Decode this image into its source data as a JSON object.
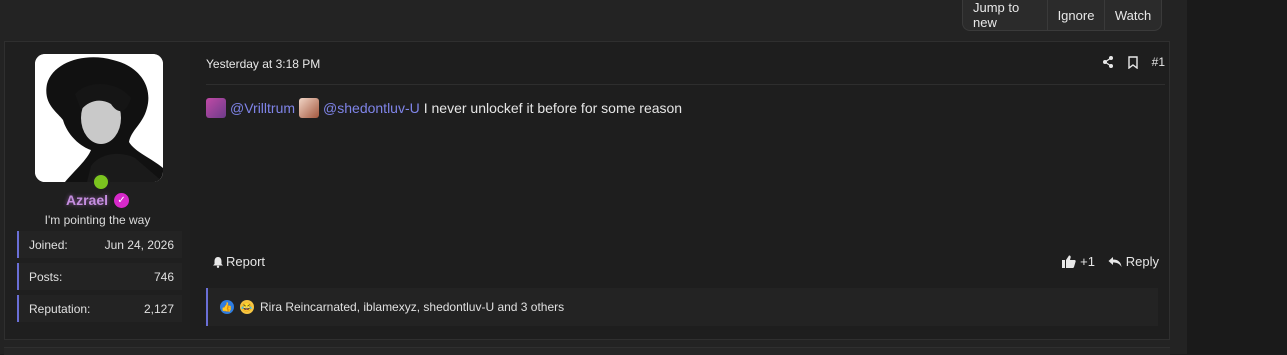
{
  "thread_actions": {
    "jump_to_new": "Jump to new",
    "ignore": "Ignore",
    "watch": "Watch"
  },
  "user": {
    "name": "Azrael",
    "title": "I'm pointing the way",
    "stats": [
      {
        "label": "Joined:",
        "value": "Jun 24, 2026"
      },
      {
        "label": "Posts:",
        "value": "746"
      },
      {
        "label": "Reputation:",
        "value": "2,127"
      }
    ],
    "status": "online"
  },
  "post": {
    "date": "Yesterday at 3:18 PM",
    "number": "#1",
    "mentions": [
      "@Vrilltrum",
      "@shedontluv-U"
    ],
    "text": "I never unlockef it before for some reason",
    "report_label": "Report",
    "like_label": "+1",
    "reply_label": "Reply",
    "reactions_text": "Rira Reincarnated, iblamexyz, shedontluv-U and 3 others"
  },
  "colors": {
    "accent": "#6a6fd6",
    "mention": "#7f84e8",
    "username": "#c58ee0",
    "online": "#7bc41f"
  }
}
